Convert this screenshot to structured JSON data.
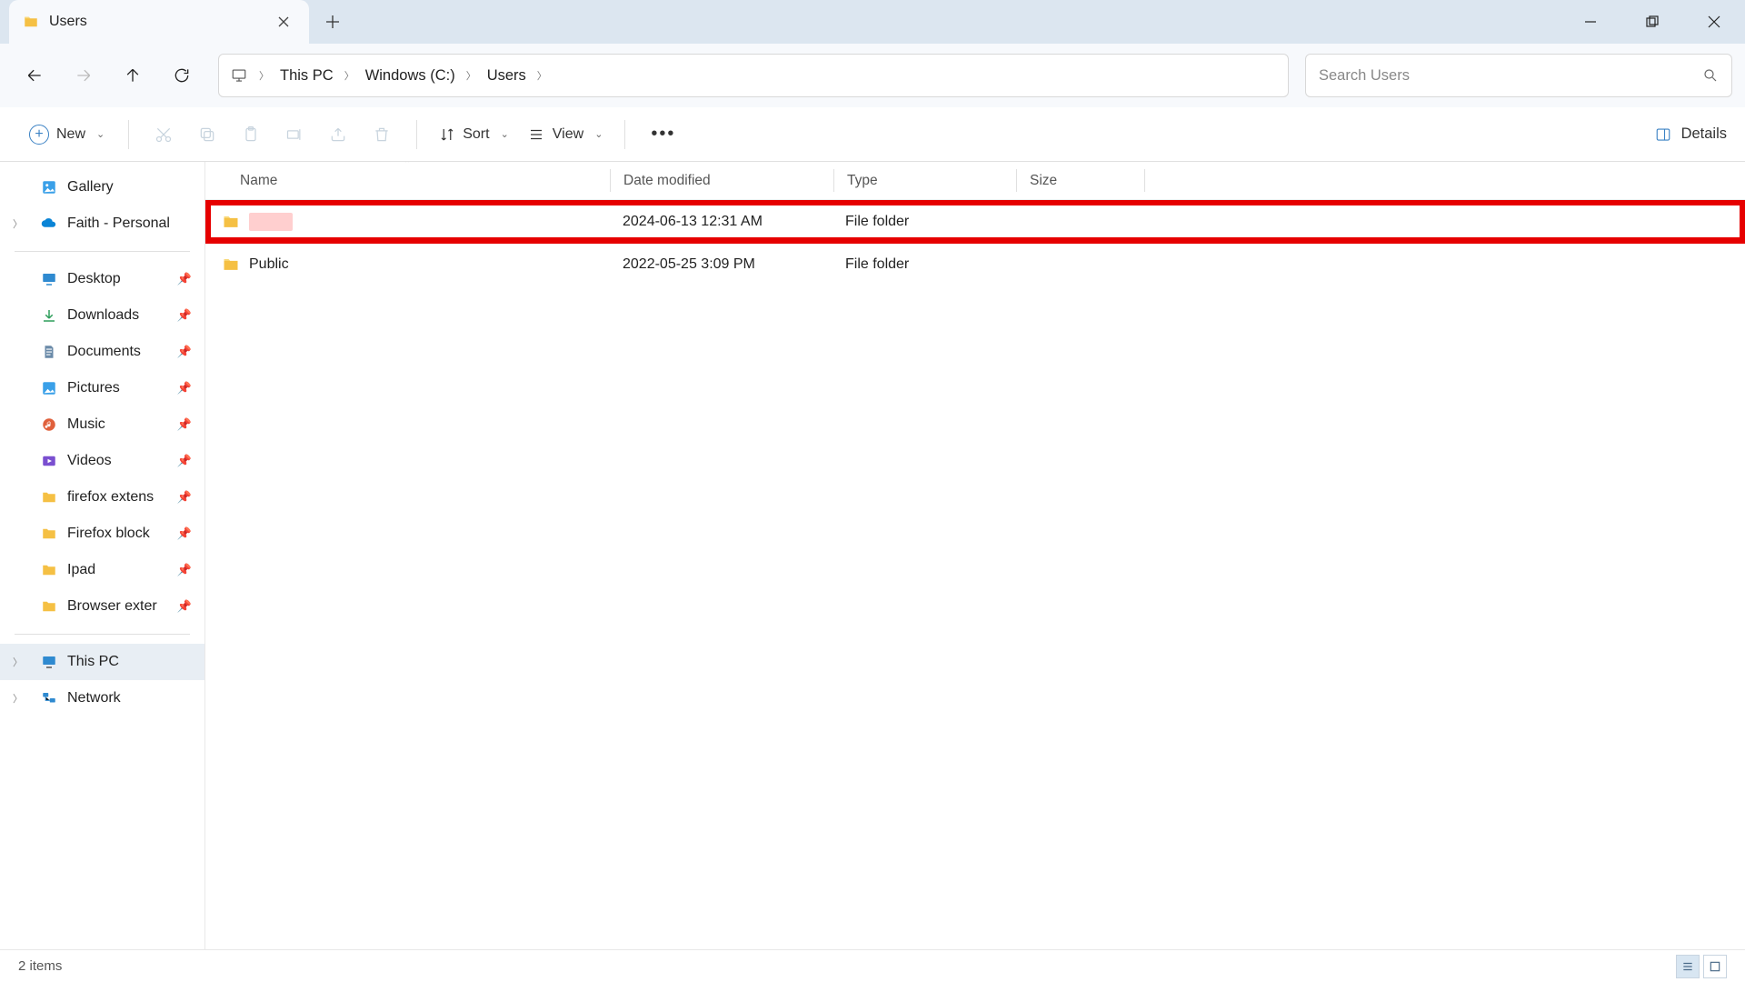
{
  "tab": {
    "title": "Users"
  },
  "nav": {
    "breadcrumbs": [
      "This PC",
      "Windows (C:)",
      "Users"
    ]
  },
  "search": {
    "placeholder": "Search Users"
  },
  "toolbar": {
    "new_label": "New",
    "sort_label": "Sort",
    "view_label": "View",
    "details_label": "Details"
  },
  "sidebar": {
    "top": [
      {
        "label": "Gallery",
        "icon": "gallery"
      },
      {
        "label": "Faith - Personal",
        "icon": "onedrive",
        "expandable": true
      }
    ],
    "quick": [
      {
        "label": "Desktop",
        "icon": "desktop",
        "pinned": true
      },
      {
        "label": "Downloads",
        "icon": "downloads",
        "pinned": true
      },
      {
        "label": "Documents",
        "icon": "documents",
        "pinned": true
      },
      {
        "label": "Pictures",
        "icon": "pictures",
        "pinned": true
      },
      {
        "label": "Music",
        "icon": "music",
        "pinned": true
      },
      {
        "label": "Videos",
        "icon": "videos",
        "pinned": true
      },
      {
        "label": "firefox extens",
        "icon": "folder",
        "pinned": true
      },
      {
        "label": "Firefox block",
        "icon": "folder",
        "pinned": true
      },
      {
        "label": "Ipad",
        "icon": "folder",
        "pinned": true
      },
      {
        "label": "Browser exter",
        "icon": "folder",
        "pinned": true
      }
    ],
    "bottom": [
      {
        "label": "This PC",
        "icon": "pc",
        "expandable": true,
        "selected": true
      },
      {
        "label": "Network",
        "icon": "network",
        "expandable": true
      }
    ]
  },
  "columns": {
    "name": "Name",
    "date": "Date modified",
    "type": "Type",
    "size": "Size"
  },
  "rows": [
    {
      "name": "",
      "redacted": true,
      "date": "2024-06-13 12:31 AM",
      "type": "File folder",
      "size": "",
      "highlighted": true
    },
    {
      "name": "Public",
      "date": "2022-05-25 3:09 PM",
      "type": "File folder",
      "size": ""
    }
  ],
  "status": {
    "text": "2 items"
  }
}
